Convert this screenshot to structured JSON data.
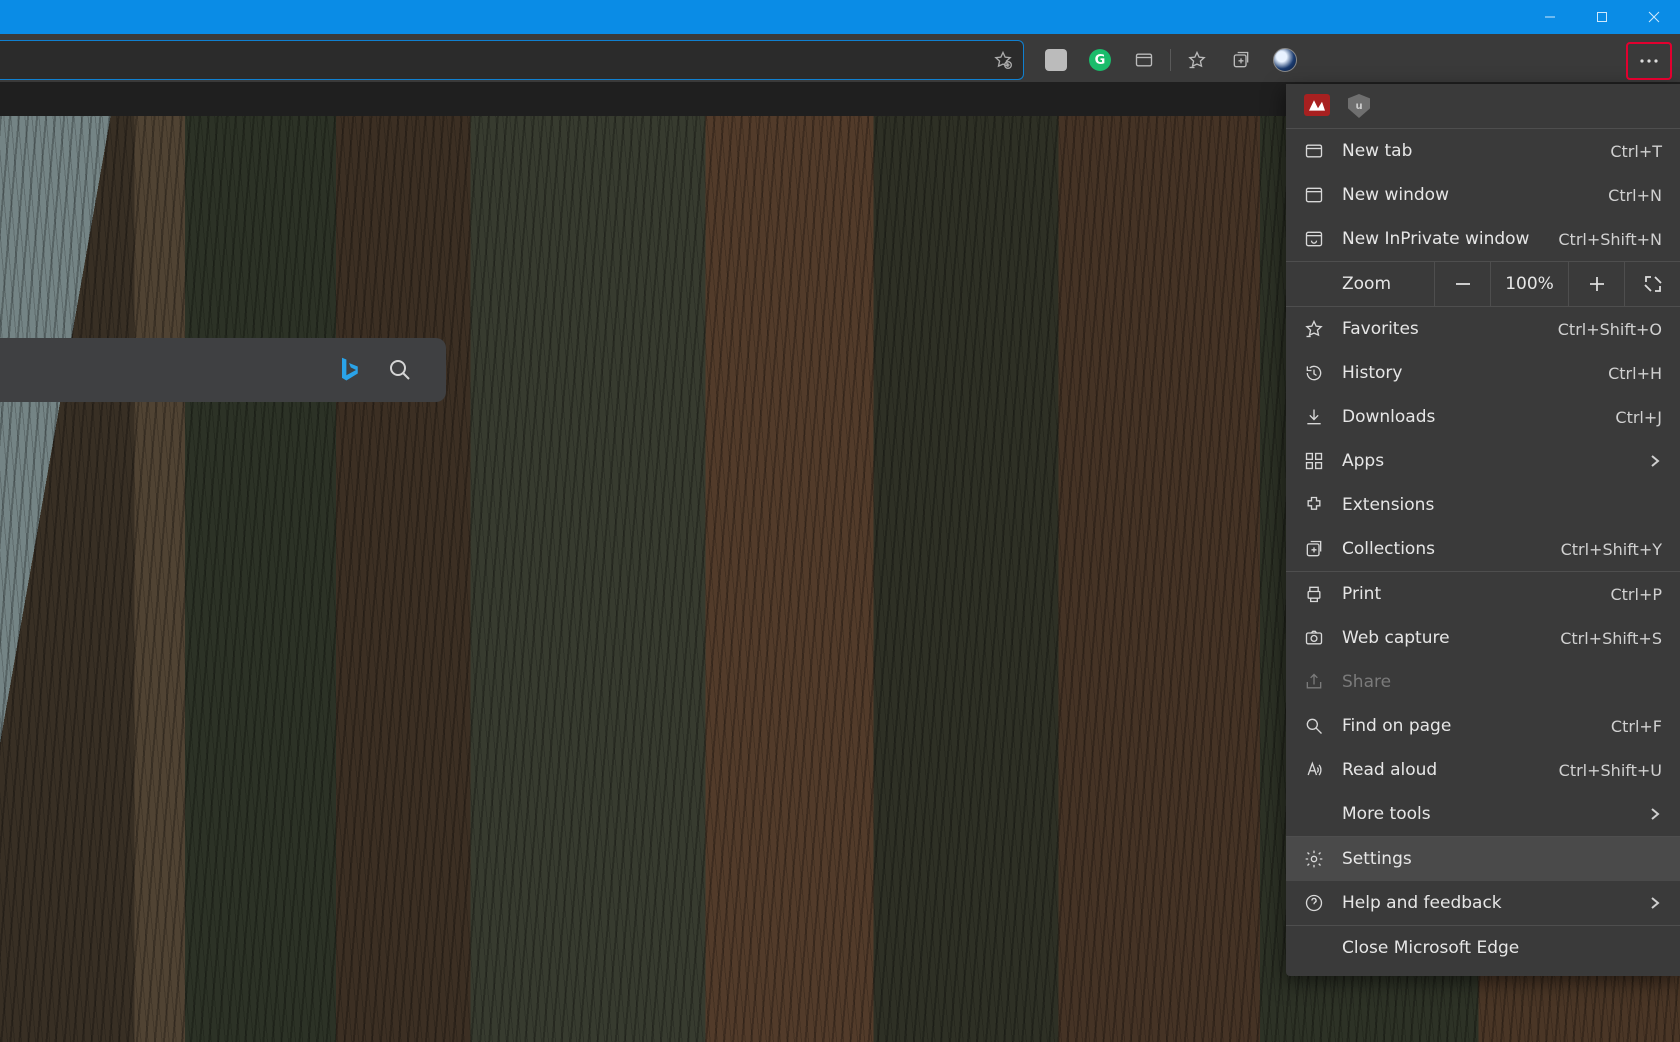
{
  "window": {
    "minimize": "—",
    "maximize": "▢",
    "close": "✕"
  },
  "toolbar": {
    "add_fav_tooltip": "Add this page to favorites"
  },
  "menu": {
    "new_tab": {
      "label": "New tab",
      "shortcut": "Ctrl+T"
    },
    "new_window": {
      "label": "New window",
      "shortcut": "Ctrl+N"
    },
    "new_inprivate": {
      "label": "New InPrivate window",
      "shortcut": "Ctrl+Shift+N"
    },
    "zoom": {
      "label": "Zoom",
      "value": "100%"
    },
    "favorites": {
      "label": "Favorites",
      "shortcut": "Ctrl+Shift+O"
    },
    "history": {
      "label": "History",
      "shortcut": "Ctrl+H"
    },
    "downloads": {
      "label": "Downloads",
      "shortcut": "Ctrl+J"
    },
    "apps": {
      "label": "Apps"
    },
    "extensions": {
      "label": "Extensions"
    },
    "collections": {
      "label": "Collections",
      "shortcut": "Ctrl+Shift+Y"
    },
    "print": {
      "label": "Print",
      "shortcut": "Ctrl+P"
    },
    "web_capture": {
      "label": "Web capture",
      "shortcut": "Ctrl+Shift+S"
    },
    "share": {
      "label": "Share"
    },
    "find": {
      "label": "Find on page",
      "shortcut": "Ctrl+F"
    },
    "read_aloud": {
      "label": "Read aloud",
      "shortcut": "Ctrl+Shift+U"
    },
    "more_tools": {
      "label": "More tools"
    },
    "settings": {
      "label": "Settings"
    },
    "help": {
      "label": "Help and feedback"
    },
    "close_edge": {
      "label": "Close Microsoft Edge"
    }
  }
}
